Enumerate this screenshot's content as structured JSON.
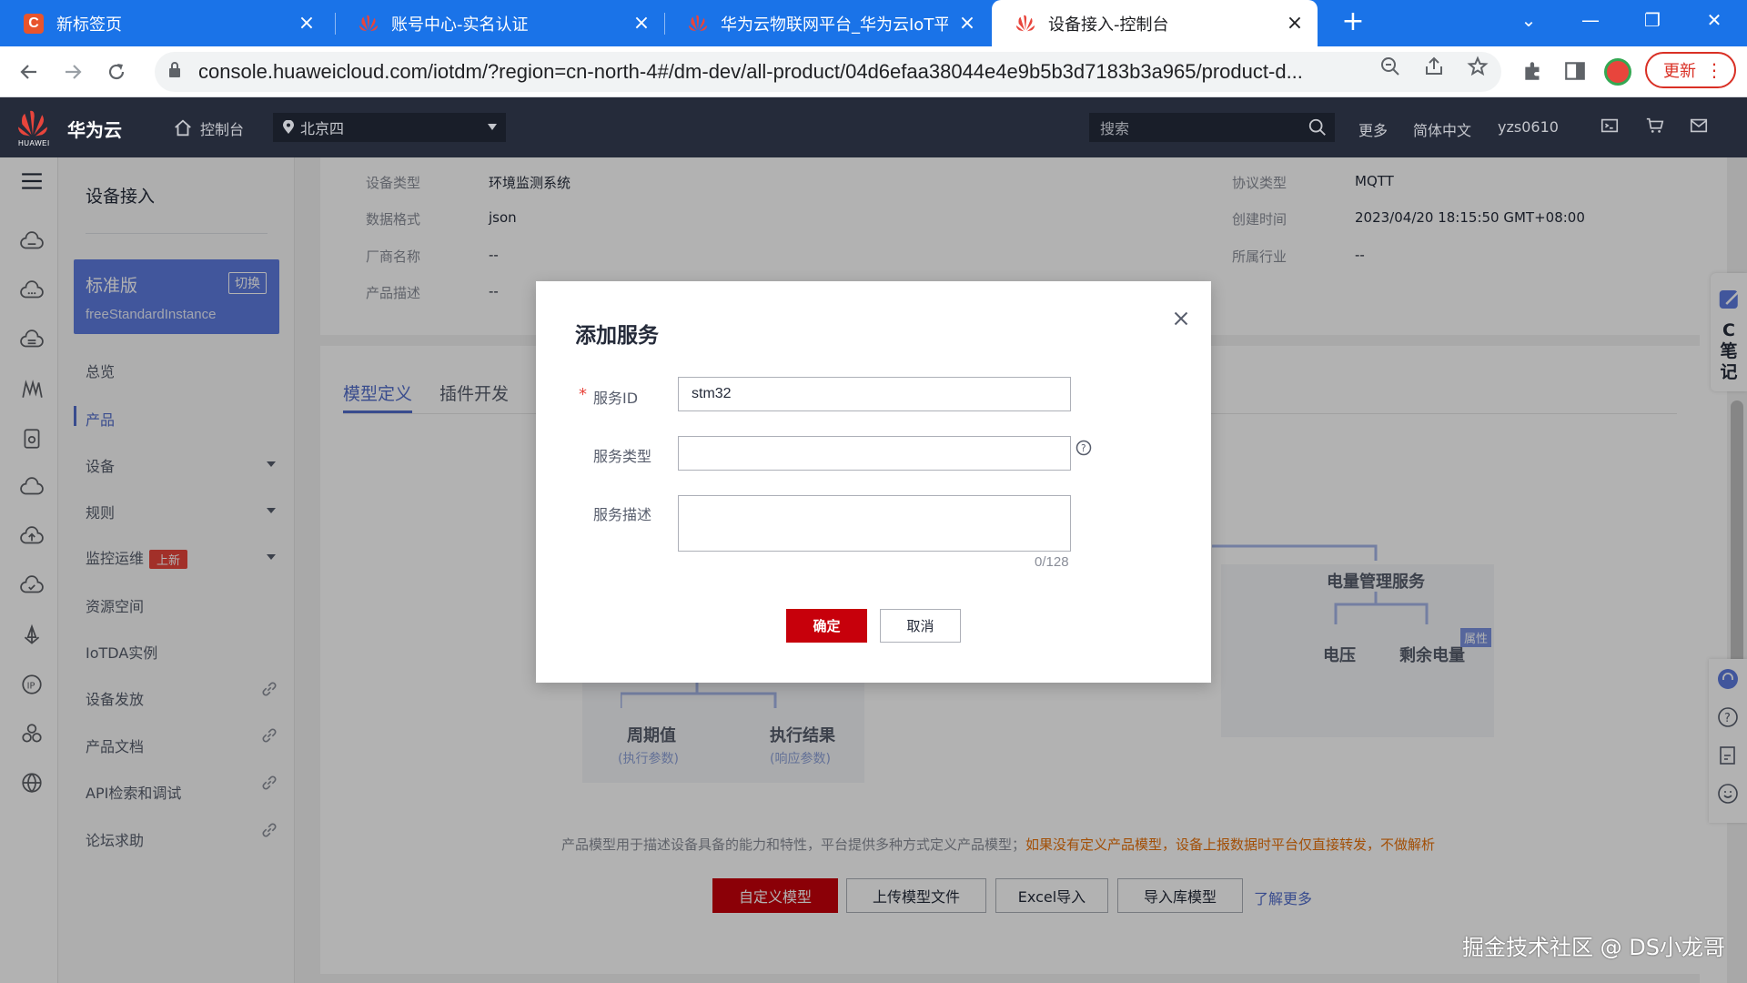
{
  "browser": {
    "tabs": [
      {
        "title": "新标签页",
        "favicon": "c-logo-icon"
      },
      {
        "title": "账号中心-实名认证",
        "favicon": "huawei-logo-icon"
      },
      {
        "title": "华为云物联网平台_华为云IoT平台",
        "favicon": "huawei-logo-icon"
      },
      {
        "title": "设备接入-控制台",
        "favicon": "huawei-logo-icon"
      }
    ],
    "active_tab": 3,
    "url": "console.huaweicloud.com/iotdm/?region=cn-north-4#/dm-dev/all-product/04d6efaa38044e4e9b5b3d7183b3a965/product-d...",
    "update_label": "更新"
  },
  "console_header": {
    "logo_text": "HUAWEI",
    "brand": "华为云",
    "home_label": "控制台",
    "region": "北京四",
    "search_placeholder": "搜索",
    "more": "更多",
    "language": "简体中文",
    "user": "yzs0610"
  },
  "sidebar": {
    "title": "设备接入",
    "edition": "标准版",
    "switch_label": "切换",
    "instance_id": "freeStandardInstance",
    "items": [
      {
        "label": "总览"
      },
      {
        "label": "产品"
      },
      {
        "label": "设备"
      },
      {
        "label": "规则"
      },
      {
        "label": "监控运维",
        "badge": "上新"
      },
      {
        "label": "资源空间"
      },
      {
        "label": "IoTDA实例"
      },
      {
        "label": "设备发放"
      },
      {
        "label": "产品文档"
      },
      {
        "label": "API检索和调试"
      },
      {
        "label": "论坛求助"
      }
    ],
    "active_item": "产品"
  },
  "product_info": {
    "left": [
      {
        "key": "设备类型",
        "value": "环境监测系统"
      },
      {
        "key": "数据格式",
        "value": "json"
      },
      {
        "key": "厂商名称",
        "value": "--"
      },
      {
        "key": "产品描述",
        "value": "--"
      }
    ],
    "right": [
      {
        "key": "协议类型",
        "value": "MQTT"
      },
      {
        "key": "创建时间",
        "value": "2023/04/20 18:15:50 GMT+08:00"
      },
      {
        "key": "所属行业",
        "value": "--"
      }
    ]
  },
  "content": {
    "tabs": [
      "模型定义",
      "插件开发"
    ],
    "active_tab": "模型定义",
    "diagram": {
      "power_service": "电量管理服务",
      "voltage": "电压",
      "remaining_power": "剩余电量",
      "property_tag": "属性",
      "period": "周期值",
      "period_sub": "(执行参数)",
      "result": "执行结果",
      "result_sub": "(响应参数)"
    },
    "hint": "产品模型用于描述设备具备的能力和特性，平台提供多种方式定义产品模型；",
    "hint_warn": "如果没有定义产品模型，设备上报数据时平台仅直接转发，不做解析",
    "buttons": {
      "custom": "自定义模型",
      "upload": "上传模型文件",
      "excel": "Excel导入",
      "import_lib": "导入库模型"
    },
    "learn_more": "了解更多"
  },
  "side_note": {
    "letter": "C",
    "text": "笔记"
  },
  "watermark": "掘金技术社区 @ DS小龙哥",
  "dialog": {
    "title": "添加服务",
    "fields": {
      "service_id_label": "服务ID",
      "service_id_value": "stm32",
      "service_type_label": "服务类型",
      "service_type_value": "",
      "service_desc_label": "服务描述",
      "service_desc_value": ""
    },
    "char_count": "0/128",
    "confirm": "确定",
    "cancel": "取消"
  },
  "colors": {
    "chrome_blue": "#1a73e8",
    "console_header": "#252b3a",
    "accent": "#526ecc",
    "primary_button": "#c7000b",
    "warning_text": "#e8710a"
  }
}
